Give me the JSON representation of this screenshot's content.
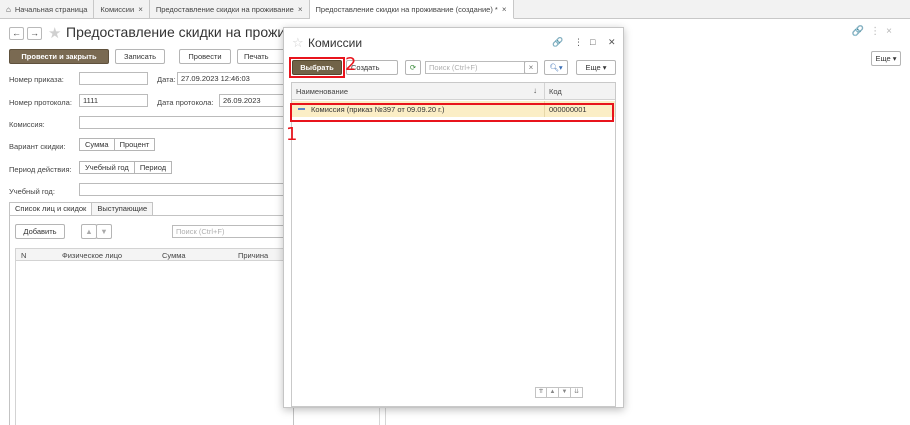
{
  "tabs": [
    {
      "label": "Начальная страница",
      "close": ""
    },
    {
      "label": "Комиссии",
      "close": "×"
    },
    {
      "label": "Предоставление скидки на проживание",
      "close": "×"
    },
    {
      "label": "Предоставление скидки на проживание (создание) *",
      "close": "×"
    }
  ],
  "form": {
    "title": "Предоставление скидки на прожива",
    "more_label": "Еще",
    "buttons": {
      "post_close": "Провести и закрыть",
      "save": "Записать",
      "post": "Провести",
      "print": "Печать"
    },
    "fields": {
      "order_number_label": "Номер приказа:",
      "order_number_value": "",
      "date_label": "Дата:",
      "date_value": "27.09.2023 12:46:03",
      "protocol_number_label": "Номер протокола:",
      "protocol_number_value": "1111",
      "protocol_date_label": "Дата протокола:",
      "protocol_date_value": "26.09.2023",
      "commission_label": "Комиссия:",
      "commission_value": "",
      "discount_variant_label": "Вариант скидки:",
      "discount_variant_options": [
        "Сумма",
        "Процент"
      ],
      "period_label": "Период действия:",
      "period_options": [
        "Учебный год",
        "Период"
      ],
      "school_year_label": "Учебный год:",
      "school_year_value": ""
    },
    "panel_tabs": [
      "Список лиц и скидок",
      "Выступающие"
    ],
    "add_button": "Добавить",
    "search_placeholder": "Поиск (Ctrl+F)",
    "grid_columns": [
      "N",
      "Физическое лицо",
      "Сумма",
      "Причина"
    ]
  },
  "dialog": {
    "title": "Комиссии",
    "select_button": "Выбрать",
    "create_button": "Создать",
    "search_placeholder": "Поиск (Ctrl+F)",
    "more_label": "Еще",
    "columns": {
      "name": "Наименование",
      "sort_icon": "↓",
      "code": "Код"
    },
    "rows": [
      {
        "name": "Комиссия (приказ №397 от 09.09.20 г.)",
        "code": "000000001"
      }
    ]
  },
  "annotations": {
    "marker_1": "1",
    "marker_2": "2"
  },
  "colors": {
    "highlight": "#e8141c",
    "primary_button": "#7a6a52",
    "selected_row": "#fbeec6"
  }
}
